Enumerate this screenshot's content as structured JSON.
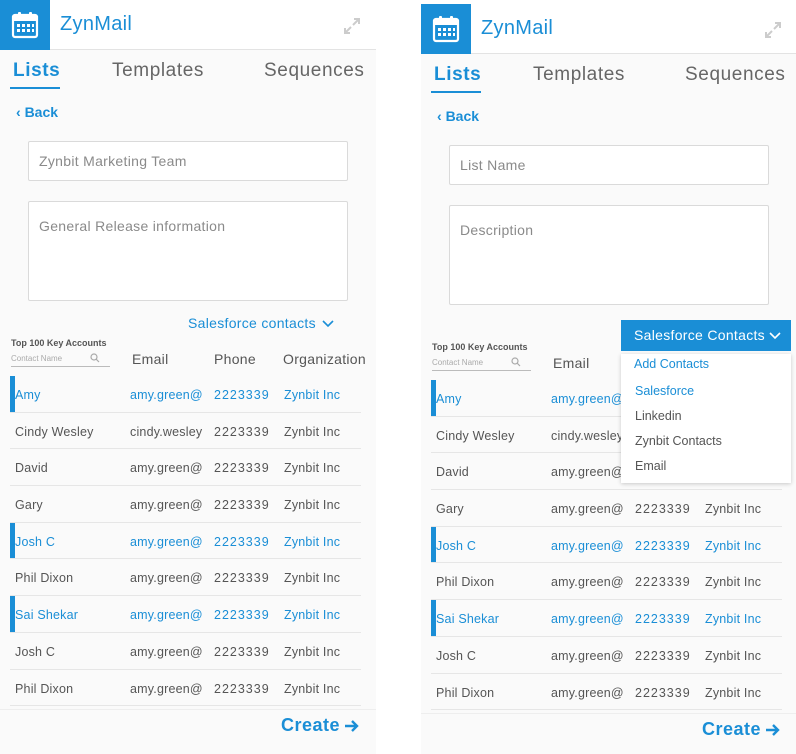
{
  "app_title": "ZynMail",
  "tabs": [
    "Lists",
    "Templates",
    "Sequences"
  ],
  "back_label": "Back",
  "left": {
    "list_name_value": "Zynbit Marketing Team",
    "description_value": "General Release information",
    "source_label": "Salesforce contacts"
  },
  "right": {
    "list_name_placeholder": "List Name",
    "description_placeholder": "Description",
    "dropdown_label": "Salesforce Contacts",
    "dropdown": {
      "header": "Add Contacts",
      "items": [
        "Salesforce",
        "Linkedin",
        "Zynbit Contacts",
        "Email"
      ]
    }
  },
  "filter": {
    "title": "Top 100 Key Accounts",
    "placeholder": "Contact Name"
  },
  "columns": [
    "Email",
    "Phone",
    "Organization"
  ],
  "rows": [
    {
      "name": "Amy",
      "email": "amy.green@",
      "phone": "2223339",
      "org": "Zynbit Inc",
      "selected": true
    },
    {
      "name": "Cindy Wesley",
      "email": "cindy.wesley",
      "phone": "2223339",
      "org": "Zynbit Inc",
      "selected": false
    },
    {
      "name": "David",
      "email": "amy.green@",
      "phone": "2223339",
      "org": "Zynbit Inc",
      "selected": false
    },
    {
      "name": "Gary",
      "email": "amy.green@",
      "phone": "2223339",
      "org": "Zynbit Inc",
      "selected": false
    },
    {
      "name": "Josh C",
      "email": "amy.green@",
      "phone": "2223339",
      "org": "Zynbit Inc",
      "selected": true
    },
    {
      "name": "Phil Dixon",
      "email": "amy.green@",
      "phone": "2223339",
      "org": "Zynbit Inc",
      "selected": false
    },
    {
      "name": "Sai Shekar",
      "email": "amy.green@",
      "phone": "2223339",
      "org": "Zynbit Inc",
      "selected": true
    },
    {
      "name": "Josh C",
      "email": "amy.green@",
      "phone": "2223339",
      "org": "Zynbit Inc",
      "selected": false
    },
    {
      "name": "Phil Dixon",
      "email": "amy.green@",
      "phone": "2223339",
      "org": "Zynbit Inc",
      "selected": false
    }
  ],
  "create_label": "Create",
  "colors": {
    "accent": "#1a8ed6",
    "text": "#555555",
    "border": "#dadada"
  }
}
